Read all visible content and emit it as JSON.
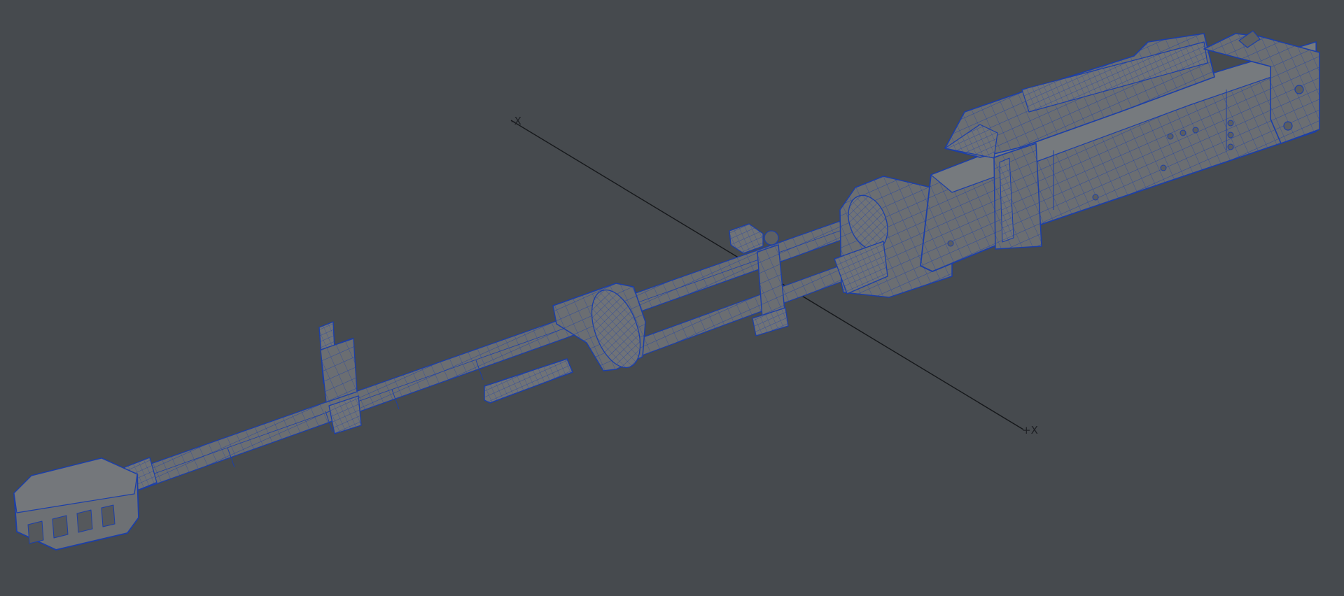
{
  "viewport": {
    "background": "#464a4e",
    "wire_color": "#1c3fa8",
    "surface_color": "#6b6e72",
    "axis_color": "#16181b"
  },
  "axis": {
    "negative_label": "-X",
    "positive_label": "+X"
  },
  "model": {
    "parts": [
      "muzzle-brake",
      "barrel",
      "front-sight",
      "gas-block",
      "gas-tube",
      "carry-handle-bracket",
      "rear-clamp",
      "receiver",
      "feed-cover",
      "charging-handle",
      "recoil-spring-housing"
    ]
  }
}
